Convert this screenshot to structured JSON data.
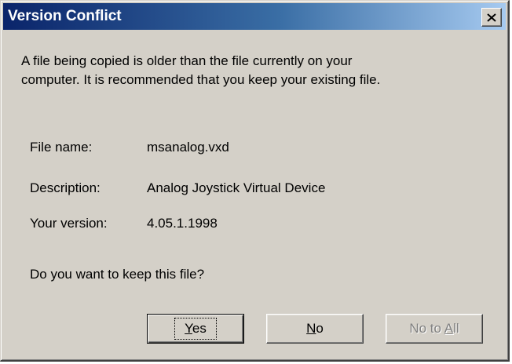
{
  "dialog": {
    "title": "Version Conflict",
    "message_line1": "A file being copied is older than the file currently on your",
    "message_line2": "computer. It is recommended that you keep your existing file.",
    "fields": [
      {
        "label": "File name:",
        "value": "msanalog.vxd"
      },
      {
        "label": "Description:",
        "value": "Analog Joystick Virtual Device"
      },
      {
        "label": "Your version:",
        "value": "4.05.1.1998"
      }
    ],
    "question": "Do you want to keep this file?",
    "buttons": {
      "yes": {
        "mnemonic": "Y",
        "rest": "es",
        "enabled": true,
        "default": true
      },
      "no": {
        "mnemonic": "N",
        "rest": "o",
        "enabled": true
      },
      "no_to_all_prefix": "No to ",
      "no_to_all_mnemonic": "A",
      "no_to_all_rest": "ll",
      "no_to_all_enabled": false
    },
    "close_icon": "close-icon"
  },
  "colors": {
    "face": "#d4d0c8",
    "title_start": "#0a246a",
    "title_end": "#a6caf0",
    "disabled_text": "#808080"
  }
}
